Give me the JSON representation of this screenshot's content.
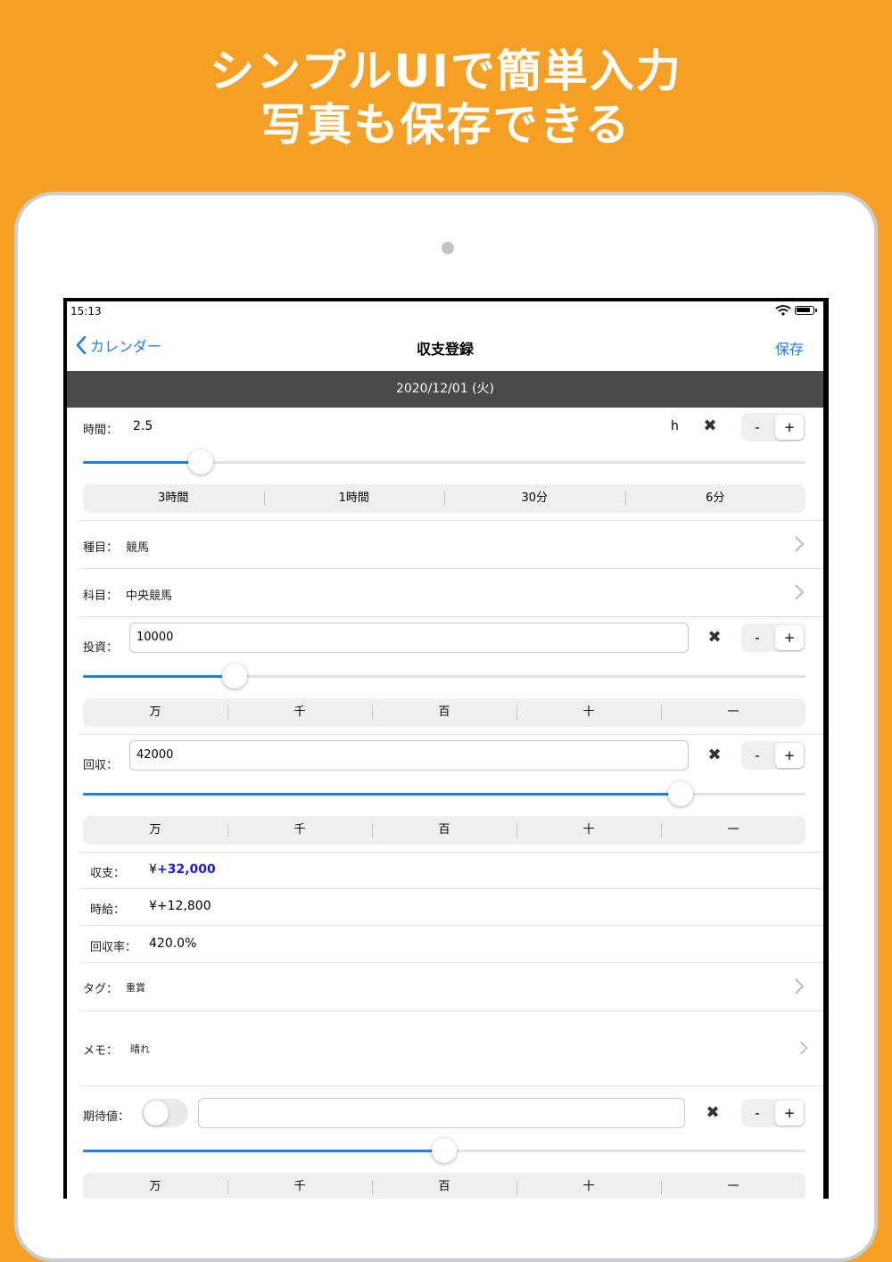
{
  "headline": {
    "line1": "シンプルUIで簡単入力",
    "line2": "写真も保存できる"
  },
  "status": {
    "time": "15:13"
  },
  "nav": {
    "back_label": "カレンダー",
    "title": "収支登録",
    "save_label": "保存"
  },
  "date": "2020/12/01 (火)",
  "time_row": {
    "label": "時間：",
    "value": "2.5",
    "unit": "h",
    "clear": "✖",
    "minus": "-",
    "plus": "+",
    "slider_fraction": 0.163
  },
  "time_seg": [
    "3時間",
    "1時間",
    "30分",
    "6分"
  ],
  "category": {
    "label": "種目：",
    "value": "競馬"
  },
  "subject": {
    "label": "科目：",
    "value": "中央競馬"
  },
  "invest": {
    "label": "投資：",
    "value": "10000",
    "clear": "✖",
    "minus": "-",
    "plus": "+",
    "slider_fraction": 0.21
  },
  "invest_seg": [
    "万",
    "千",
    "百",
    "十",
    "一"
  ],
  "recover": {
    "label": "回収：",
    "value": "42000",
    "clear": "✖",
    "minus": "-",
    "plus": "+",
    "slider_fraction": 0.827
  },
  "recover_seg": [
    "万",
    "千",
    "百",
    "十",
    "一"
  ],
  "balance": {
    "label": "収支：",
    "prefix": "¥",
    "value": "+32,000",
    "color": "#1A1AE6"
  },
  "hourly": {
    "label": "時給：",
    "value": "¥+12,800"
  },
  "rate": {
    "label": "回収率：",
    "value": "420.0%"
  },
  "tag": {
    "label": "タグ：",
    "value": "重賞"
  },
  "memo": {
    "label": "メモ：",
    "value": "晴れ"
  },
  "expect": {
    "label": "期待値：",
    "value": "",
    "clear": "✖",
    "minus": "-",
    "plus": "+",
    "slider_fraction": 0.5
  },
  "expect_seg": [
    "万",
    "千",
    "百",
    "十",
    "一"
  ],
  "colors": {
    "background": "#F5A025",
    "accent": "#1E7CF2",
    "datebar": "#4A4A4A"
  }
}
